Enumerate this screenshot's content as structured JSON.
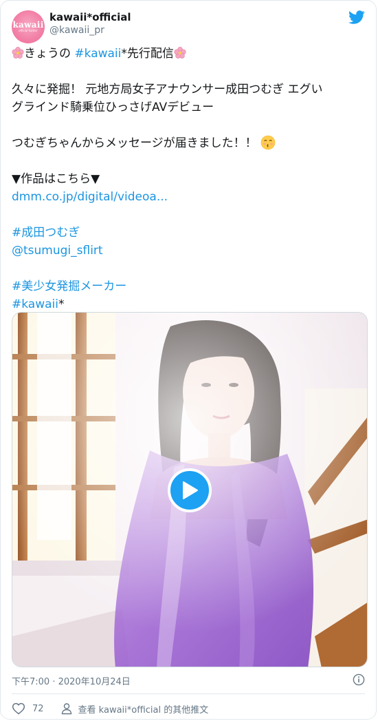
{
  "account": {
    "display_name": "kawaii*official",
    "handle": "@kawaii_pr",
    "avatar_text": "kawaii",
    "avatar_subtext": "official twitter"
  },
  "tweet": {
    "line1": {
      "pre": "きょうの ",
      "hashtag": "#kawaii",
      "post": "*先行配信"
    },
    "line2": "久々に発掘！ 元地方局女子アナウンサー成田つむぎ エグい",
    "line3": "グラインド騎乗位ひっさげAVデビュー",
    "line4": "つむぎちゃんからメッセージが届きました！！",
    "line5": "▼作品はこちら▼",
    "link": "dmm.co.jp/digital/videoa...",
    "hashtag_actress": "#成田つむぎ",
    "mention": "@tsumugi_sflirt",
    "hashtag_maker": "#美少女発掘メーカー",
    "hashtag_brand": "#kawaii",
    "hashtag_brand_suffix": "*"
  },
  "timestamp": "下午7:00 · 2020年10月24日",
  "actions": {
    "like_count": "72",
    "profile_link_label": "查看 kawaii*official 的其他推文"
  },
  "icons": {
    "bird": "twitter-bird-icon",
    "blossom": "cherry-blossom-emoji",
    "kiss": "kissing-face-emoji",
    "play": "play-icon",
    "info": "info-icon",
    "heart": "heart-icon",
    "person": "person-icon"
  },
  "colors": {
    "accent": "#1da1f2",
    "link": "#1b95e0",
    "text": "#14171a",
    "secondary": "#657786",
    "avatar_pink": "#f27fa6"
  }
}
